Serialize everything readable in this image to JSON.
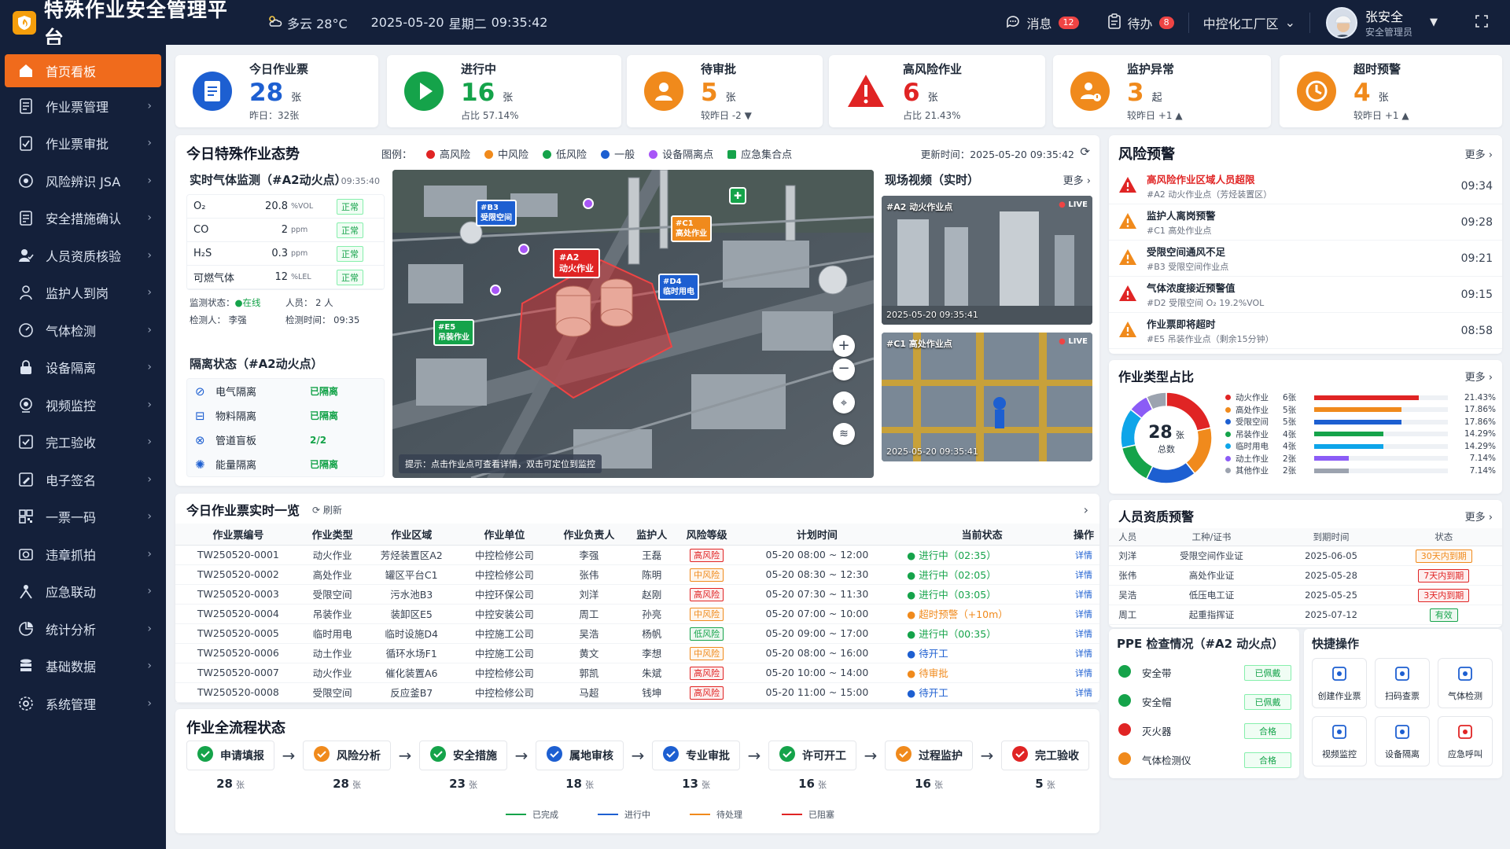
{
  "header": {
    "title": "特殊作业安全管理平台",
    "weather": "多云 28°C",
    "date": "2025-05-20",
    "weekday": "星期二",
    "time": "09:35:42",
    "messages_label": "消息",
    "messages_count": "12",
    "todo_label": "待办",
    "todo_count": "8",
    "plant": "中控化工厂区",
    "user_name": "张安全",
    "user_role": "安全管理员"
  },
  "sidebar": {
    "items": [
      {
        "label": "首页看板",
        "icon": "home-icon"
      },
      {
        "label": "作业票管理",
        "icon": "ticket-icon"
      },
      {
        "label": "作业票审批",
        "icon": "approve-icon"
      },
      {
        "label": "风险辨识 JSA",
        "icon": "risk-icon"
      },
      {
        "label": "安全措施确认",
        "icon": "checklist-icon"
      },
      {
        "label": "人员资质核验",
        "icon": "person-verify-icon"
      },
      {
        "label": "监护人到岗",
        "icon": "guard-icon"
      },
      {
        "label": "气体检测",
        "icon": "gas-icon"
      },
      {
        "label": "设备隔离",
        "icon": "lock-icon"
      },
      {
        "label": "视频监控",
        "icon": "camera-icon"
      },
      {
        "label": "完工验收",
        "icon": "finish-icon"
      },
      {
        "label": "电子签名",
        "icon": "sign-icon"
      },
      {
        "label": "一票一码",
        "icon": "qrcode-icon"
      },
      {
        "label": "违章抓拍",
        "icon": "snapshot-icon"
      },
      {
        "label": "应急联动",
        "icon": "emergency-icon"
      },
      {
        "label": "统计分析",
        "icon": "pie-icon"
      },
      {
        "label": "基础数据",
        "icon": "database-icon"
      },
      {
        "label": "系统管理",
        "icon": "settings-icon"
      }
    ]
  },
  "stats": [
    {
      "label": "今日作业票",
      "value": "28",
      "unit": "张",
      "sub": "昨日：32张",
      "color": "#1d5fd1"
    },
    {
      "label": "进行中",
      "value": "16",
      "unit": "张",
      "sub": "占比 57.14%",
      "color": "#15a34a"
    },
    {
      "label": "待审批",
      "value": "5",
      "unit": "张",
      "sub": "较昨日 -2 ▼",
      "color": "#f08a1c"
    },
    {
      "label": "高风险作业",
      "value": "6",
      "unit": "张",
      "sub": "占比 21.43%",
      "color": "#e02424"
    },
    {
      "label": "监护异常",
      "value": "3",
      "unit": "起",
      "sub": "较昨日 +1 ▲",
      "color": "#f08a1c"
    },
    {
      "label": "超时预警",
      "value": "4",
      "unit": "张",
      "sub": "较昨日 +1 ▲",
      "color": "#f08a1c"
    }
  ],
  "situation": {
    "title": "今日特殊作业态势",
    "legend_title": "图例：",
    "legend": [
      {
        "label": "高风险",
        "color": "#e02424"
      },
      {
        "label": "中风险",
        "color": "#f08a1c"
      },
      {
        "label": "低风险",
        "color": "#15a34a"
      },
      {
        "label": "一般",
        "color": "#1d5fd1"
      },
      {
        "label": "设备隔离点",
        "color": "#a855f7"
      },
      {
        "label": "应急集合点",
        "color": "#15a34a"
      }
    ],
    "update_time": "更新时间：2025-05-20 09:35:42"
  },
  "gas": {
    "title": "实时气体监测（#A2动火点）",
    "time": "09:35:40",
    "rows": [
      {
        "name": "O₂",
        "value": "20.8",
        "unit": "%VOL",
        "status": "正常"
      },
      {
        "name": "CO",
        "value": "2",
        "unit": "ppm",
        "status": "正常"
      },
      {
        "name": "H₂S",
        "value": "0.3",
        "unit": "ppm",
        "status": "正常"
      },
      {
        "name": "可燃气体",
        "value": "12",
        "unit": "%LEL",
        "status": "正常"
      }
    ],
    "monitor_state_label": "监测状态：",
    "monitor_state": "在线",
    "staff_label": "人员：",
    "staff": "2 人",
    "tester_label": "检测人：",
    "tester": "李强",
    "test_time_label": "检测时间：",
    "test_time": "09:35"
  },
  "isolation": {
    "title": "隔离状态（#A2动火点）",
    "rows": [
      {
        "name": "电气隔离",
        "status": "已隔离"
      },
      {
        "name": "物料隔离",
        "status": "已隔离"
      },
      {
        "name": "管道盲板",
        "status": "2/2"
      },
      {
        "name": "能量隔离",
        "status": "已隔离"
      }
    ]
  },
  "map": {
    "markers": [
      {
        "id": "#B3",
        "label": "受限空间"
      },
      {
        "id": "#C1",
        "label": "高处作业"
      },
      {
        "id": "#A2",
        "label": "动火作业"
      },
      {
        "id": "#D4",
        "label": "临时用电"
      },
      {
        "id": "#E5",
        "label": "吊装作业"
      }
    ],
    "hint": "提示：点击作业点可查看详情，双击可定位到监控"
  },
  "video": {
    "title": "现场视频（实时）",
    "more": "更多",
    "feeds": [
      {
        "name": "#A2 动火作业点",
        "live": "LIVE",
        "time": "2025-05-20 09:35:41"
      },
      {
        "name": "#C1 高处作业点",
        "live": "LIVE",
        "time": "2025-05-20 09:35:41"
      }
    ]
  },
  "alerts": {
    "title": "风险预警",
    "more": "更多",
    "items": [
      {
        "title": "高风险作业区域人员超限",
        "sub": "#A2 动火作业点（芳烃装置区）",
        "time": "09:34",
        "level": "red"
      },
      {
        "title": "监护人离岗预警",
        "sub": "#C1 高处作业点",
        "time": "09:28",
        "level": "orange"
      },
      {
        "title": "受限空间通风不足",
        "sub": "#B3 受限空间作业点",
        "time": "09:21",
        "level": "orange"
      },
      {
        "title": "气体浓度接近预警值",
        "sub": "#D2 受限空间 O₂ 19.2%VOL",
        "time": "09:15",
        "level": "red"
      },
      {
        "title": "作业票即将超时",
        "sub": "#E5 吊装作业点（剩余15分钟）",
        "time": "08:58",
        "level": "orange"
      }
    ]
  },
  "job_types": {
    "title": "作业类型占比",
    "more": "更多",
    "total": "28",
    "total_unit": "张",
    "total_label": "总数",
    "chart_data": {
      "type": "pie",
      "categories": [
        "动火作业",
        "高处作业",
        "受限空间",
        "吊装作业",
        "临时用电",
        "动土作业",
        "其他作业"
      ],
      "values": [
        6,
        5,
        5,
        4,
        4,
        2,
        2
      ],
      "units": [
        "6张",
        "5张",
        "5张",
        "4张",
        "4张",
        "2张",
        "2张"
      ],
      "percents": [
        "21.43%",
        "17.86%",
        "17.86%",
        "14.29%",
        "14.29%",
        "7.14%",
        "7.14%"
      ],
      "colors": [
        "#e02424",
        "#f08a1c",
        "#1d5fd1",
        "#15a34a",
        "#0ea5e9",
        "#8b5cf6",
        "#9ca3af"
      ]
    }
  },
  "tickets": {
    "title": "今日作业票实时一览",
    "refresh": "刷新",
    "columns": [
      "作业票编号",
      "作业类型",
      "作业区域",
      "作业单位",
      "作业负责人",
      "监护人",
      "风险等级",
      "计划时间",
      "当前状态",
      "操作"
    ],
    "rows": [
      {
        "id": "TW250520-0001",
        "type": "动火作业",
        "area": "芳烃装置区A2",
        "unit": "中控检修公司",
        "lead": "李强",
        "guard": "王磊",
        "risk": "高风险",
        "time": "05-20 08:00 ~ 12:00",
        "status": "进行中（02:35）",
        "state": "green",
        "op": "详情"
      },
      {
        "id": "TW250520-0002",
        "type": "高处作业",
        "area": "罐区平台C1",
        "unit": "中控检修公司",
        "lead": "张伟",
        "guard": "陈明",
        "risk": "中风险",
        "time": "05-20 08:30 ~ 12:30",
        "status": "进行中（02:05）",
        "state": "green",
        "op": "详情"
      },
      {
        "id": "TW250520-0003",
        "type": "受限空间",
        "area": "污水池B3",
        "unit": "中控环保公司",
        "lead": "刘洋",
        "guard": "赵刚",
        "risk": "高风险",
        "time": "05-20 07:30 ~ 11:30",
        "status": "进行中（03:05）",
        "state": "green",
        "op": "详情"
      },
      {
        "id": "TW250520-0004",
        "type": "吊装作业",
        "area": "装卸区E5",
        "unit": "中控安装公司",
        "lead": "周工",
        "guard": "孙亮",
        "risk": "中风险",
        "time": "05-20 07:00 ~ 10:00",
        "status": "超时预警（+10m）",
        "state": "orange",
        "op": "详情"
      },
      {
        "id": "TW250520-0005",
        "type": "临时用电",
        "area": "临时设施D4",
        "unit": "中控施工公司",
        "lead": "吴浩",
        "guard": "杨帆",
        "risk": "低风险",
        "time": "05-20 09:00 ~ 17:00",
        "status": "进行中（00:35）",
        "state": "green",
        "op": "详情"
      },
      {
        "id": "TW250520-0006",
        "type": "动土作业",
        "area": "循环水场F1",
        "unit": "中控施工公司",
        "lead": "黄文",
        "guard": "李想",
        "risk": "中风险",
        "time": "05-20 08:00 ~ 16:00",
        "status": "待开工",
        "state": "blue",
        "op": "详情"
      },
      {
        "id": "TW250520-0007",
        "type": "动火作业",
        "area": "催化装置A6",
        "unit": "中控检修公司",
        "lead": "郭凯",
        "guard": "朱斌",
        "risk": "高风险",
        "time": "05-20 10:00 ~ 14:00",
        "status": "待审批",
        "state": "orange",
        "op": "详情"
      },
      {
        "id": "TW250520-0008",
        "type": "受限空间",
        "area": "反应釜B7",
        "unit": "中控检修公司",
        "lead": "马超",
        "guard": "钱坤",
        "risk": "高风险",
        "time": "05-20 11:00 ~ 15:00",
        "status": "待开工",
        "state": "blue",
        "op": "详情"
      }
    ]
  },
  "process": {
    "title": "作业全流程状态",
    "steps": [
      {
        "label": "申请填报",
        "count": "28",
        "unit": "张",
        "color": "#15a34a"
      },
      {
        "label": "风险分析",
        "count": "28",
        "unit": "张",
        "color": "#f08a1c"
      },
      {
        "label": "安全措施",
        "count": "23",
        "unit": "张",
        "color": "#15a34a"
      },
      {
        "label": "属地审核",
        "count": "18",
        "unit": "张",
        "color": "#1d5fd1"
      },
      {
        "label": "专业审批",
        "count": "13",
        "unit": "张",
        "color": "#1d5fd1"
      },
      {
        "label": "许可开工",
        "count": "16",
        "unit": "张",
        "color": "#15a34a"
      },
      {
        "label": "过程监护",
        "count": "16",
        "unit": "张",
        "color": "#f08a1c"
      },
      {
        "label": "完工验收",
        "count": "5",
        "unit": "张",
        "color": "#e02424"
      }
    ],
    "legend": [
      {
        "label": "已完成",
        "color": "#15a34a"
      },
      {
        "label": "进行中",
        "color": "#1d5fd1"
      },
      {
        "label": "待处理",
        "color": "#f08a1c"
      },
      {
        "label": "已阻塞",
        "color": "#e02424"
      }
    ]
  },
  "qualification": {
    "title": "人员资质预警",
    "more": "更多",
    "columns": [
      "人员",
      "工种/证书",
      "到期时间",
      "状态"
    ],
    "rows": [
      {
        "name": "刘洋",
        "cert": "受限空间作业证",
        "date": "2025-06-05",
        "status": "30天内到期",
        "tone": "orange"
      },
      {
        "name": "张伟",
        "cert": "高处作业证",
        "date": "2025-05-28",
        "status": "7天内到期",
        "tone": "red"
      },
      {
        "name": "吴浩",
        "cert": "低压电工证",
        "date": "2025-05-25",
        "status": "3天内到期",
        "tone": "red"
      },
      {
        "name": "周工",
        "cert": "起重指挥证",
        "date": "2025-07-12",
        "status": "有效",
        "tone": "green"
      }
    ]
  },
  "ppe": {
    "title": "PPE 检查情况（#A2 动火点）",
    "rows": [
      {
        "name": "安全带",
        "status": "已佩戴",
        "icon": "harness-icon"
      },
      {
        "name": "安全帽",
        "status": "已佩戴",
        "icon": "helmet-icon"
      },
      {
        "name": "灭火器",
        "status": "合格",
        "icon": "extinguisher-icon"
      },
      {
        "name": "气体检测仪",
        "status": "合格",
        "icon": "gas-detector-icon"
      }
    ]
  },
  "quick": {
    "title": "快捷操作",
    "items": [
      {
        "label": "创建作业票",
        "icon": "create-ticket-icon"
      },
      {
        "label": "扫码查票",
        "icon": "scan-icon"
      },
      {
        "label": "气体检测",
        "icon": "gas-test-icon"
      },
      {
        "label": "视频监控",
        "icon": "video-icon"
      },
      {
        "label": "设备隔离",
        "icon": "isolation-icon"
      },
      {
        "label": "应急呼叫",
        "icon": "phone-icon"
      }
    ]
  }
}
